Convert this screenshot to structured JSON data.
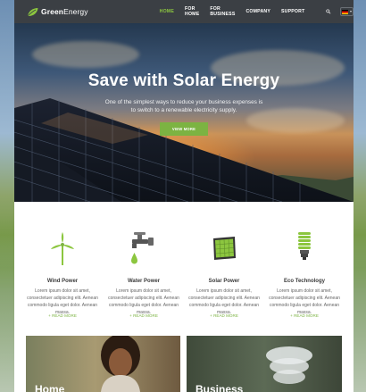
{
  "brand": {
    "name_bold": "Green",
    "name_thin": "Energy",
    "accent": "#8cc63f",
    "nav_bg": "#3b3f44",
    "leaf_icon": "leaf-icon"
  },
  "nav": {
    "items": [
      {
        "label": "HOME",
        "active": true
      },
      {
        "label": "FOR HOME",
        "active": false
      },
      {
        "label": "FOR BUSINESS",
        "active": false
      },
      {
        "label": "COMPANY",
        "active": false
      },
      {
        "label": "SUPPORT",
        "active": false
      }
    ],
    "search_icon": "search-icon",
    "language_flag": "flag-germany-icon"
  },
  "hero": {
    "title": "Save with Solar Energy",
    "subtitle": "One of the simplest ways to reduce your business expenses is to switch to a renewable electricity supply.",
    "button": "VIEW MORE"
  },
  "features": [
    {
      "icon": "wind-turbine-icon",
      "title": "Wind Power",
      "text": "Lorem ipsum dolor sit amet, consectetuer adipiscing elit. Aenean commodo ligula eget dolor. Aenean massa.",
      "link": "+ READ MORE"
    },
    {
      "icon": "water-faucet-icon",
      "title": "Water Power",
      "text": "Lorem ipsum dolor sit amet, consectetuer adipiscing elit. Aenean commodo ligula eget dolor. Aenean massa.",
      "link": "+ READ MORE"
    },
    {
      "icon": "solar-panel-icon",
      "title": "Solar Power",
      "text": "Lorem ipsum dolor sit amet, consectetuer adipiscing elit. Aenean commodo ligula eget dolor. Aenean massa.",
      "link": "+ READ MORE"
    },
    {
      "icon": "eco-bulb-icon",
      "title": "Eco Technology",
      "text": "Lorem ipsum dolor sit amet, consectetuer adipiscing elit. Aenean commodo ligula eget dolor. Aenean massa.",
      "link": "+ READ MORE"
    }
  ],
  "cards": [
    {
      "title": "Home"
    },
    {
      "title": "Business"
    }
  ]
}
